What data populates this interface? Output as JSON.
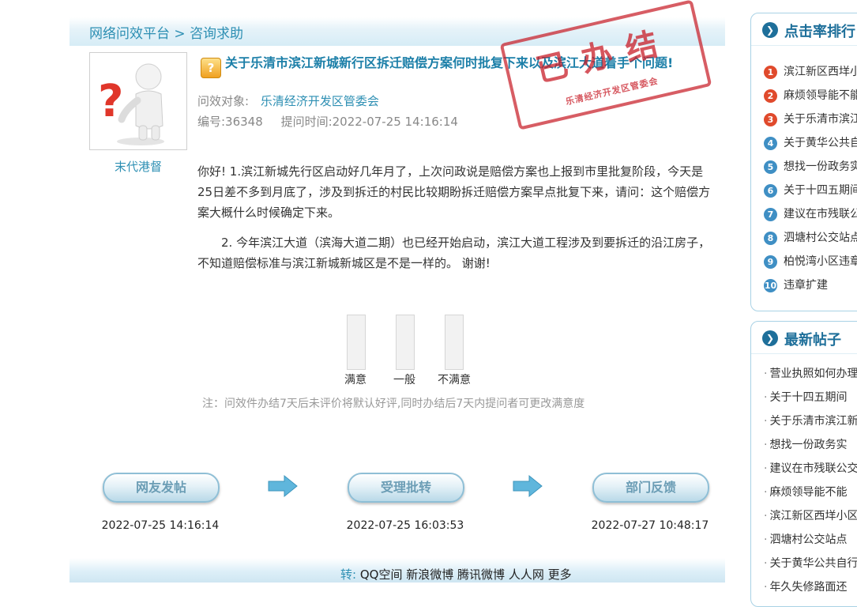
{
  "breadcrumb": {
    "site": "网络问效平台",
    "sep": ">",
    "section": "咨询求助"
  },
  "user": {
    "name": "末代港督"
  },
  "question": {
    "title": "关于乐清市滨江新城新行区拆迁赔偿方案何时批复下来以及滨江大道着手个问题!",
    "target_label": "问效对象:",
    "target_value": "乐清经济开发区管委会",
    "id_text": "编号:36348",
    "time_text": "提问时间:2022-07-25 14:16:14",
    "paragraph1": "你好! 1.滨江新城先行区启动好几年月了，上次问政说是赔偿方案也上报到市里批复阶段，今天是25日差不多到月底了，涉及到拆迁的村民比较期盼拆迁赔偿方案早点批复下来，请问：这个赔偿方案大概什么时候确定下来。",
    "paragraph2": "2. 今年滨江大道（滨海大道二期）也已经开始启动，滨江大道工程涉及到要拆迁的沿江房子，不知道赔偿标准与滨江新城新城区是不是一样的。  谢谢!"
  },
  "stamp": {
    "main": "已办结",
    "sub": "乐清经济开发区管委会"
  },
  "rating": {
    "options": [
      "满意",
      "一般",
      "不满意"
    ],
    "note": "注：问效件办结7天后未评价将默认好评,同时办结后7天内提问者可更改满意度"
  },
  "flow": [
    {
      "label": "网友发帖",
      "time": "2022-07-25 14:16:14"
    },
    {
      "label": "受理批转",
      "time": "2022-07-25 16:03:53"
    },
    {
      "label": "部门反馈",
      "time": "2022-07-27 10:48:17"
    }
  ],
  "share": {
    "lead": "转:",
    "links": [
      "QQ空间",
      "新浪微博",
      "腾讯微博",
      "人人网",
      "更多"
    ]
  },
  "rank_panel": {
    "title": "点击率排行",
    "items": [
      {
        "num": "1",
        "text": "滨江新区西垟小"
      },
      {
        "num": "2",
        "text": "麻烦领导能不能"
      },
      {
        "num": "3",
        "text": "关于乐清市滨江"
      },
      {
        "num": "4",
        "text": "关于黄华公共自"
      },
      {
        "num": "5",
        "text": "想找一份政务实"
      },
      {
        "num": "6",
        "text": "关于十四五期间"
      },
      {
        "num": "7",
        "text": "建议在市残联公"
      },
      {
        "num": "8",
        "text": "泗塘村公交站点"
      },
      {
        "num": "9",
        "text": "柏悦湾小区违章"
      },
      {
        "num": "10",
        "text": "违章扩建"
      }
    ],
    "num_colors": [
      "#e04a2c",
      "#e04a2c",
      "#e04a2c",
      "#3f8fc4",
      "#3f8fc4",
      "#3f8fc4",
      "#3f8fc4",
      "#3f8fc4",
      "#3f8fc4",
      "#3f8fc4"
    ]
  },
  "new_panel": {
    "title": "最新帖子",
    "items": [
      "营业执照如何办理",
      "关于十四五期间",
      "关于乐清市滨江新",
      "想找一份政务实",
      "建议在市残联公交",
      "麻烦领导能不能",
      "滨江新区西垟小区",
      "泗塘村公交站点",
      "关于黄华公共自行",
      "年久失修路面还"
    ]
  },
  "colors": {
    "accent": "#2d8fb3",
    "title": "#1c7fa8",
    "stamp": "#c81e28",
    "panel": "#1e6f9a"
  }
}
